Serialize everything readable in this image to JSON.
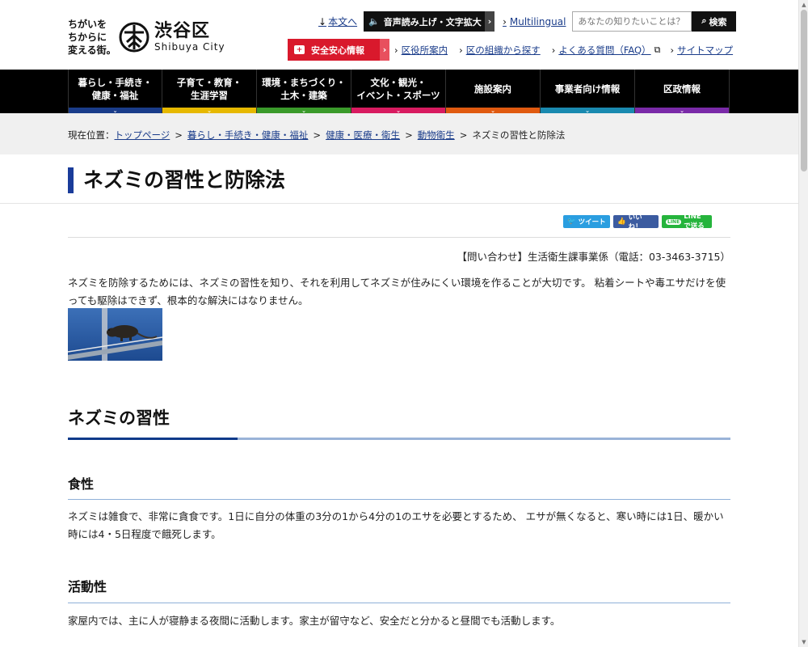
{
  "header": {
    "logo_tagline": "ちがいを\nちからに\n変える街。",
    "logo_name_jp": "渋谷区",
    "logo_name_en": "Shibuya City",
    "skip_link": "本文へ",
    "voice_button": "音声読み上げ・文字拡大",
    "multilingual": "Multilingual",
    "search_placeholder": "あなたの知りたいことは？",
    "search_button": "検索",
    "safety_button": "安全安心情報",
    "links": [
      {
        "label": "区役所案内"
      },
      {
        "label": "区の組織から探す"
      },
      {
        "label": "よくある質問（FAQ）"
      },
      {
        "label": "サイトマップ"
      }
    ]
  },
  "gnav": [
    {
      "label": "暮らし・手続き・\n健康・福祉",
      "color": "#1a3c8a"
    },
    {
      "label": "子育て・教育・\n生涯学習",
      "color": "#e6b800"
    },
    {
      "label": "環境・まちづくり・\n土木・建築",
      "color": "#3a9a2a"
    },
    {
      "label": "文化・観光・\nイベント・スポーツ",
      "color": "#d81b60"
    },
    {
      "label": "施設案内",
      "color": "#e05a10"
    },
    {
      "label": "事業者向け情報",
      "color": "#1a8ab0"
    },
    {
      "label": "区政情報",
      "color": "#7a2aa8"
    }
  ],
  "breadcrumb": {
    "prefix": "現在位置：",
    "items": [
      "トップページ",
      "暮らし・手続き・健康・福祉",
      "健康・医療・衛生",
      "動物衛生"
    ],
    "current": "ネズミの習性と防除法"
  },
  "page": {
    "title": "ネズミの習性と防除法",
    "social": {
      "tweet": "ツイート",
      "like": "いいね！",
      "line": "LINEで送る"
    },
    "contact": "【問い合わせ】生活衛生課事業係（電話：03-3463-3715）",
    "intro": "ネズミを防除するためには、ネズミの習性を知り、それを利用してネズミが住みにくい環境を作ることが大切です。 粘着シートや毒エサだけを使っても駆除はできず、根本的な解決にはなりません。",
    "section_title": "ネズミの習性",
    "sub1_title": "食性",
    "sub1_text": "ネズミは雑食で、非常に貪食です。1日に自分の体重の3分の1から4分の1のエサを必要とするため、 エサが無くなると、寒い時には1日、暖かい時には4・5日程度で餓死します。",
    "sub2_title": "活動性",
    "sub2_text": "家屋内では、主に人が寝静まる夜間に活動します。家主が留守など、安全だと分かると昼間でも活動します。"
  }
}
